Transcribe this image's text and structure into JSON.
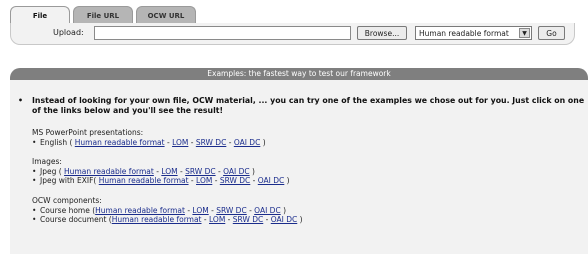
{
  "tabs": [
    "File",
    "File URL",
    "OCW URL"
  ],
  "upload": {
    "label": "Upload:",
    "file_value": "",
    "browse_label": "Browse...",
    "format_selected": "Human readable format",
    "go_label": "Go"
  },
  "examples": {
    "header": "Examples: the fastest way to test our framework",
    "intro": "Instead of looking for your own file, OCW material, ... you can try one of the examples we chose out for you. Just click on one of the links below and you'll see the result!",
    "groups": [
      {
        "title": "MS PowerPoint presentations:",
        "items": [
          {
            "name": "English ( ",
            "links": [
              "Human readable format",
              "LOM",
              "SRW DC",
              "OAI DC"
            ],
            "close": " )"
          }
        ]
      },
      {
        "title": "Images:",
        "items": [
          {
            "name": "Jpeg ( ",
            "links": [
              "Human readable format",
              "LOM",
              "SRW DC",
              "OAI DC"
            ],
            "close": " )"
          },
          {
            "name": "Jpeg with EXIF( ",
            "links": [
              "Human readable format",
              "LOM",
              "SRW DC",
              "OAI DC"
            ],
            "close": " )"
          }
        ]
      },
      {
        "title": "OCW components:",
        "items": [
          {
            "name": "Course home (",
            "links": [
              "Human readable format",
              "LOM",
              "SRW DC",
              "OAI DC"
            ],
            "close": " )"
          },
          {
            "name": "Course document (",
            "links": [
              "Human readable format",
              "LOM",
              "SRW DC",
              "OAI DC"
            ],
            "close": " )"
          }
        ]
      }
    ]
  },
  "colors": {
    "header_bg": "#7f7f7f",
    "panel_bg": "#f2f2f2",
    "link": "#1a2c8c"
  }
}
